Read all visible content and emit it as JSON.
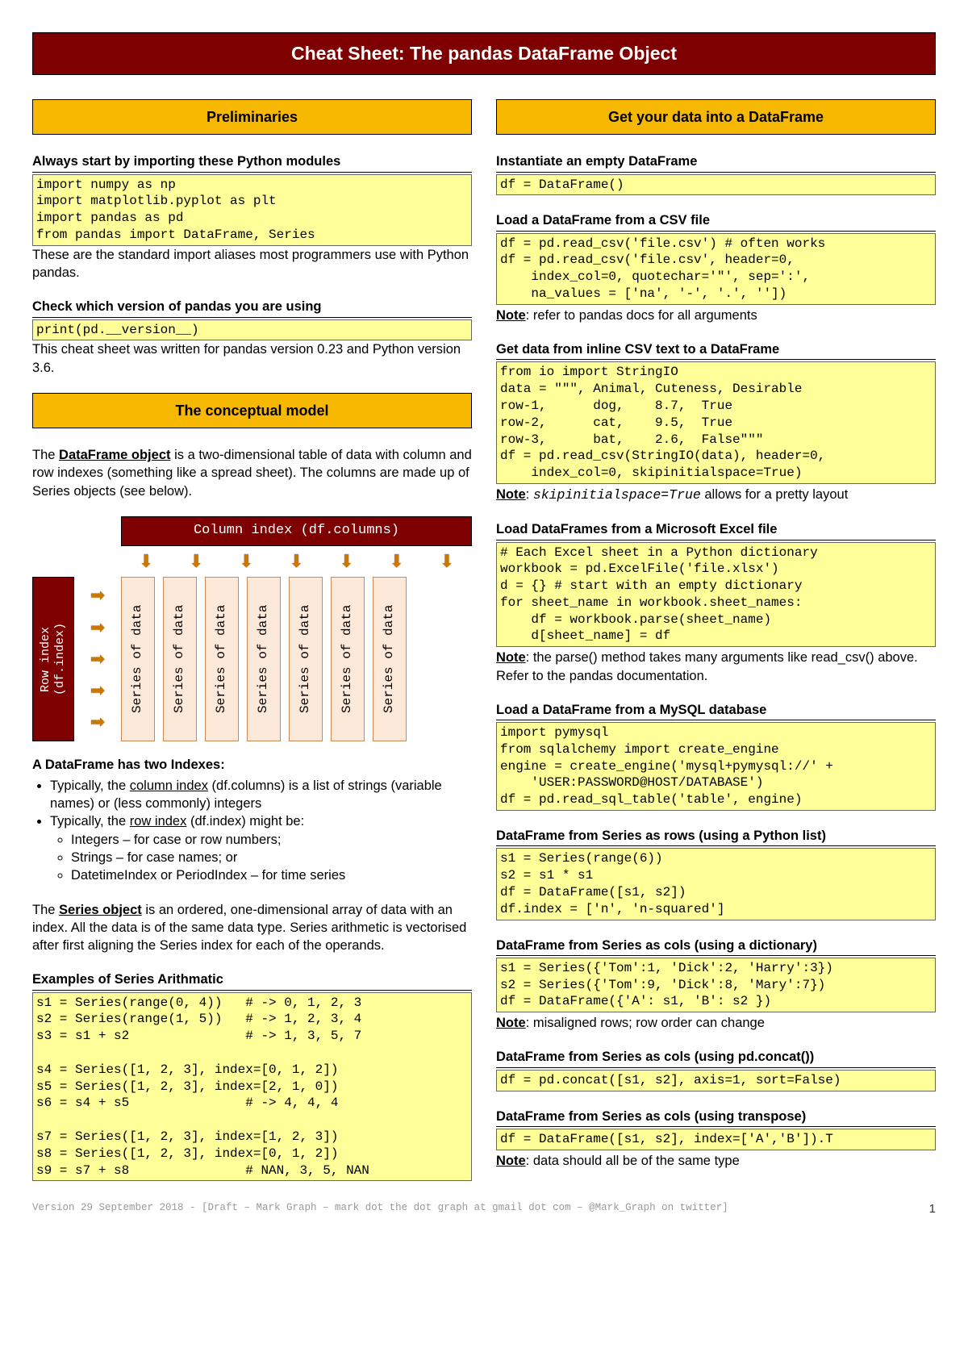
{
  "title": "Cheat Sheet: The pandas DataFrame Object",
  "left": {
    "sec1": "Preliminaries",
    "sub1": "Always start by importing these Python modules",
    "code1": "import numpy as np\nimport matplotlib.pyplot as plt\nimport pandas as pd\nfrom pandas import DataFrame, Series",
    "txt1": "These are the standard import aliases most programmers use with Python pandas.",
    "sub2": "Check which version of pandas you are using",
    "code2": "print(pd.__version__)",
    "txt2": "This cheat sheet was written for pandas version 0.23 and Python version 3.6.",
    "sec2": "The conceptual model",
    "para1a": "The ",
    "para1b": "DataFrame object",
    "para1c": " is a two-dimensional table of data with column and row indexes (something like a spread sheet). The columns are made up of Series objects (see below).",
    "diagColHdr": "Column index (df.columns)",
    "diagRowHdr": "Row index\n(df.index)",
    "diagSeries": "Series of data",
    "sub3": "A DataFrame has two Indexes:",
    "b1a": "Typically, the ",
    "b1b": "column index",
    "b1c": " (df.columns) is a list of strings (variable names) or (less commonly) integers",
    "b2a": "Typically, the ",
    "b2b": "row index",
    "b2c": " (df.index) might be:",
    "b2s1": "Integers – for case or row numbers;",
    "b2s2": "Strings – for case names; or",
    "b2s3": "DatetimeIndex or PeriodIndex – for time series",
    "para2a": "The ",
    "para2b": "Series object",
    "para2c": " is an ordered, one-dimensional array of data with an index. All the data is of the same data type. Series arithmetic is vectorised after first aligning the Series index for each of the operands.",
    "sub4": "Examples of Series Arithmatic",
    "code3": "s1 = Series(range(0, 4))   # -> 0, 1, 2, 3\ns2 = Series(range(1, 5))   # -> 1, 2, 3, 4\ns3 = s1 + s2               # -> 1, 3, 5, 7\n\ns4 = Series([1, 2, 3], index=[0, 1, 2])\ns5 = Series([1, 2, 3], index=[2, 1, 0])\ns6 = s4 + s5               # -> 4, 4, 4\n\ns7 = Series([1, 2, 3], index=[1, 2, 3])\ns8 = Series([1, 2, 3], index=[0, 1, 2])\ns9 = s7 + s8               # NAN, 3, 5, NAN"
  },
  "right": {
    "sec1": "Get your data into a DataFrame",
    "sub1": "Instantiate an empty DataFrame",
    "code1": "df = DataFrame()",
    "sub2": "Load a DataFrame from a CSV file",
    "code2": "df = pd.read_csv('file.csv') # often works\ndf = pd.read_csv('file.csv', header=0,\n    index_col=0, quotechar='\"', sep=':',\n    na_values = ['na', '-', '.', ''])",
    "note2a": "Note",
    "note2b": ": refer to pandas docs for all arguments",
    "sub3": "Get data from inline CSV text to a DataFrame",
    "code3": "from io import StringIO\ndata = \"\"\", Animal, Cuteness, Desirable\nrow-1,      dog,    8.7,  True\nrow-2,      cat,    9.5,  True\nrow-3,      bat,    2.6,  False\"\"\"\ndf = pd.read_csv(StringIO(data), header=0,\n    index_col=0, skipinitialspace=True)",
    "note3a": "Note",
    "note3b": ": ",
    "note3c": "skipinitialspace=True",
    "note3d": " allows for a pretty layout",
    "sub4": "Load DataFrames from a Microsoft Excel file",
    "code4": "# Each Excel sheet in a Python dictionary\nworkbook = pd.ExcelFile('file.xlsx')\nd = {} # start with an empty dictionary\nfor sheet_name in workbook.sheet_names:\n    df = workbook.parse(sheet_name)\n    d[sheet_name] = df",
    "note4a": "Note",
    "note4b": ": the parse() method takes many arguments like read_csv() above. Refer to the pandas documentation.",
    "sub5": "Load a DataFrame from a MySQL database",
    "code5": "import pymysql\nfrom sqlalchemy import create_engine\nengine = create_engine('mysql+pymysql://' +\n    'USER:PASSWORD@HOST/DATABASE')\ndf = pd.read_sql_table('table', engine)",
    "sub6": "DataFrame from Series as rows (using a Python list)",
    "code6": "s1 = Series(range(6))\ns2 = s1 * s1\ndf = DataFrame([s1, s2])\ndf.index = ['n', 'n-squared']",
    "sub7": "DataFrame from Series as cols (using a dictionary)",
    "code7": "s1 = Series({'Tom':1, 'Dick':2, 'Harry':3})\ns2 = Series({'Tom':9, 'Dick':8, 'Mary':7})\ndf = DataFrame({'A': s1, 'B': s2 })",
    "note7a": "Note",
    "note7b": ": misaligned rows; row order can change",
    "sub8": "DataFrame from Series as cols (using pd.concat())",
    "code8": "df = pd.concat([s1, s2], axis=1, sort=False)",
    "sub9": "DataFrame from Series as cols (using transpose)",
    "code9": "df = DataFrame([s1, s2], index=['A','B']).T",
    "note9a": "Note",
    "note9b": ": data should all be of the same type"
  },
  "footer": "Version 29 September 2018 - [Draft – Mark Graph – mark dot the dot graph at gmail dot com – @Mark_Graph on twitter]",
  "pagenum": "1"
}
